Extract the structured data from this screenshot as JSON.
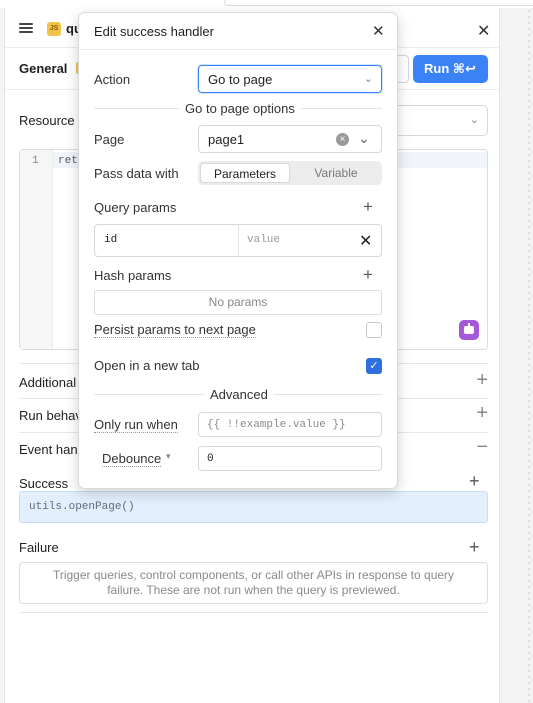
{
  "panel": {
    "query_name": "qu",
    "js_badge": "JS",
    "close_glyph": "✕",
    "tab_general": "General",
    "run_label": "Run ⌘↩",
    "resource_label": "Resource",
    "editor": {
      "line_number": "1",
      "code": "ret"
    },
    "sections": {
      "additional": "Additional",
      "run_behavior": "Run behav",
      "event_handlers": "Event hand"
    },
    "success_label": "Success",
    "success_item": "utils.openPage()",
    "failure_label": "Failure",
    "failure_hint": "Trigger queries, control components, or call other APIs in response to query failure. These are not run when the query is previewed."
  },
  "modal": {
    "title": "Edit success handler",
    "close_glyph": "✕",
    "action_label": "Action",
    "action_value": "Go to page",
    "options_heading": "Go to page options",
    "page_label": "Page",
    "page_value": "page1",
    "pass_data_label": "Pass data with",
    "pass_data_options": [
      "Parameters",
      "Variable"
    ],
    "query_params_label": "Query params",
    "query_param": {
      "key": "id",
      "value_placeholder": "value"
    },
    "hash_params_label": "Hash params",
    "no_params": "No params",
    "persist_label": "Persist params to next page",
    "persist_checked": false,
    "new_tab_label": "Open in a new tab",
    "new_tab_checked": true,
    "advanced_heading": "Advanced",
    "only_run_label": "Only run when",
    "only_run_placeholder": "{{ !!example.value }}",
    "debounce_label": "Debounce",
    "debounce_value": "0"
  },
  "colors": {
    "accent": "#3a82f6",
    "checkbox_on": "#2f6fdf",
    "success_item_bg": "#e3effd",
    "assist_icon": "#a45ad8"
  }
}
